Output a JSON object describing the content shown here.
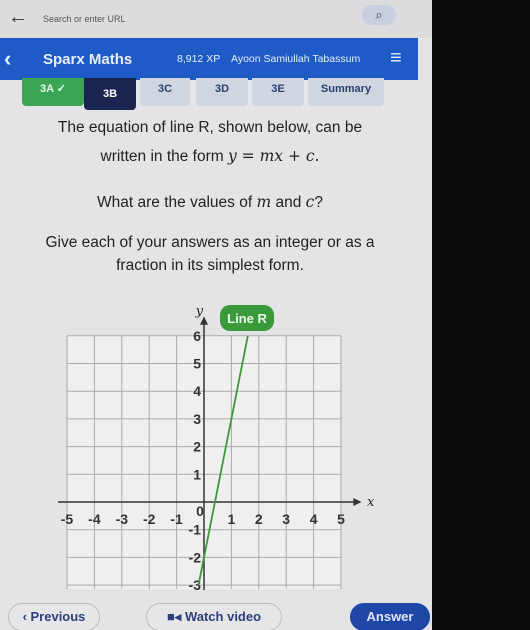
{
  "browser": {
    "url_placeholder": "Search or enter URL"
  },
  "header": {
    "back": "‹",
    "app_title": "Sparx Maths",
    "xp": "8,912 XP",
    "user": "Ayoon Samiullah Tabassum",
    "menu": "≡"
  },
  "tabs": [
    {
      "label": "3A ✓",
      "state": "done"
    },
    {
      "label": "3B",
      "state": "active"
    },
    {
      "label": "3C"
    },
    {
      "label": "3D"
    },
    {
      "label": "3E"
    },
    {
      "label": "Summary"
    }
  ],
  "question": {
    "line1": "The equation of line R, shown below, can be",
    "line2_pre": "written in the form ",
    "line2_eq": "y = mx + c.",
    "line3_pre": "What are the values of ",
    "line3_m": "m",
    "line3_mid": " and ",
    "line3_c": "c",
    "line3_end": "?",
    "line4": "Give each of your answers as an integer or as a",
    "line5": "fraction in its simplest form."
  },
  "chart_data": {
    "type": "line",
    "xlabel": "x",
    "ylabel": "y",
    "xlim": [
      -5,
      5
    ],
    "ylim": [
      -3,
      6
    ],
    "x_ticks": [
      -5,
      -4,
      -3,
      -2,
      -1,
      0,
      1,
      2,
      3,
      4,
      5
    ],
    "y_ticks": [
      -3,
      -2,
      -1,
      1,
      2,
      3,
      4,
      5,
      6
    ],
    "grid": true,
    "series": [
      {
        "name": "Line R",
        "color": "#3a9a3a",
        "points": [
          [
            -0.2,
            -3
          ],
          [
            0,
            -2
          ],
          [
            1,
            3
          ],
          [
            1.6,
            6
          ]
        ]
      }
    ]
  },
  "footer": {
    "previous": "‹ Previous",
    "watch": "Watch video",
    "answer": "Answer"
  },
  "colors": {
    "brand": "#1e5bc6",
    "done": "#3aa655",
    "active_tab": "#1b2550",
    "line": "#3a9a3a"
  }
}
